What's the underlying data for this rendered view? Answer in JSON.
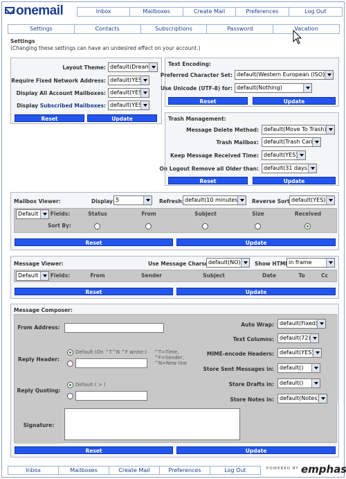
{
  "brand": {
    "logo_text": "onemail",
    "powered_by": "POWERED BY",
    "vendor": "emphasys"
  },
  "main_nav": [
    "Inbox",
    "Mailboxes",
    "Create Mail",
    "Preferences",
    "Log Out"
  ],
  "sub_nav": [
    "Settings",
    "Contacts",
    "Subscriptions",
    "Password",
    "Vacation"
  ],
  "header": {
    "title": "Settings",
    "warning": "(Changing these settings can have an undesired effect on your account.)"
  },
  "general": {
    "layout_theme_label": "Layout Theme:",
    "layout_theme": "default(Dreams)",
    "fixed_network_label": "Require Fixed Network Address:",
    "fixed_network": "default(YES)",
    "display_all_label": "Display All Account Mailboxes:",
    "display_all": "default(YES)",
    "display_label": "Display",
    "subscribed_label": "Subscribed Mailboxes:",
    "display_subscribed": "default(YES)",
    "reset": "Reset",
    "update": "Update"
  },
  "encoding": {
    "title": "Text Encoding:",
    "charset_label": "Preferred Character Set:",
    "charset": "default(Western European (ISO))",
    "utf8_label": "Use Unicode (UTF-8) for:",
    "utf8": "default(Nothing)",
    "reset": "Reset",
    "update": "Update"
  },
  "trash": {
    "title": "Trash Management:",
    "delete_method_label": "Message Delete Method:",
    "delete_method": "default(Move To Trash)",
    "trash_mailbox_label": "Trash Mailbox:",
    "trash_mailbox": "default(Trash Can)",
    "keep_received_label": "Keep Message Received Time:",
    "keep_received": "default(YES)",
    "remove_older_label": "On Logout Remove all Older than:",
    "remove_older": "default(31 days)",
    "reset": "Reset",
    "update": "Update"
  },
  "mailbox_viewer": {
    "title": "Mailbox Viewer:",
    "display_label": "Display:",
    "display": "5",
    "refresh_label": "Refresh:",
    "refresh": "default(10 minutes)",
    "reverse_label": "Reverse Sort:",
    "reverse": "default(YES)",
    "fields_select": "Default",
    "fields_label": "Fields:",
    "columns": [
      "Status",
      "From",
      "Subject",
      "Size",
      "Received"
    ],
    "sort_by_label": "Sort By:",
    "sort_selected_index": 4,
    "reset": "Reset",
    "update": "Update"
  },
  "message_viewer": {
    "title": "Message Viewer:",
    "charset_label": "Use Message Charset:",
    "charset": "default(NO)",
    "html_label": "Show HTML:",
    "html": "in frame",
    "fields_select": "Default",
    "fields_label": "Fields:",
    "columns": [
      "From",
      "Sender",
      "Subject",
      "Date",
      "To",
      "Cc"
    ],
    "reset": "Reset",
    "update": "Update"
  },
  "composer": {
    "title": "Message Composer:",
    "from_label": "From Address:",
    "from_value": "",
    "reply_header_label": "Reply Header:",
    "reply_default": "Default (On ^T^N ^F wrote:)",
    "reply_hint": "^T=Time,\n^F=Sender,\n^N=New line",
    "reply_quoting_label": "Reply Quoting:",
    "quote_default": "Default ( > )",
    "signature_label": "Signature:",
    "auto_wrap_label": "Auto Wrap:",
    "auto_wrap": "default(Fixed)",
    "text_columns_label": "Text Columns:",
    "text_columns": "default(72)",
    "mime_label": "MIME-encode Headers:",
    "mime": "default(YES)",
    "store_sent_label": "Store Sent Messages in:",
    "store_sent": "default()",
    "store_drafts_label": "Store Drafts in:",
    "store_drafts": "default()",
    "store_notes_label": "Store Notes in:",
    "store_notes": "default(Notes)",
    "reset": "Reset",
    "update": "Update"
  },
  "footer_nav": [
    "Inbox",
    "Mailboxes",
    "Create Mail",
    "Preferences",
    "Log Out"
  ]
}
